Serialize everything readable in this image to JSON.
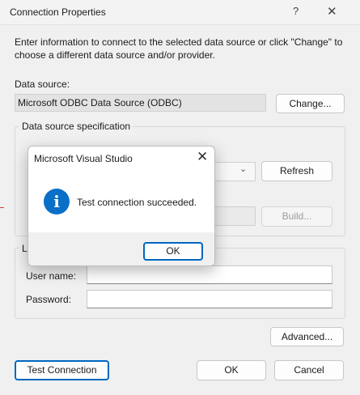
{
  "window": {
    "title": "Connection Properties",
    "help_glyph": "?",
    "close_glyph": "✕"
  },
  "description": "Enter information to connect to the selected data source or click \"Change\" to choose a different data source and/or provider.",
  "data_source": {
    "label": "Data source:",
    "value": "Microsoft ODBC Data Source (ODBC)",
    "change_label": "Change..."
  },
  "spec_group": {
    "label": "Data source specification",
    "refresh_label": "Refresh",
    "build_label": "Build..."
  },
  "login_group": {
    "label_fragment": "L",
    "user_name_label": "User name:",
    "user_name_value": "",
    "password_label": "Password:",
    "password_value": ""
  },
  "buttons": {
    "advanced": "Advanced...",
    "test_connection": "Test Connection",
    "ok": "OK",
    "cancel": "Cancel"
  },
  "message_box": {
    "title": "Microsoft Visual Studio",
    "message": "Test connection succeeded.",
    "ok_label": "OK",
    "icon_glyph": "i",
    "close_glyph": "✕"
  },
  "colors": {
    "accent": "#0067c0",
    "info_icon": "#0a6fc7",
    "dialog_bg": "#f0f0f0"
  }
}
